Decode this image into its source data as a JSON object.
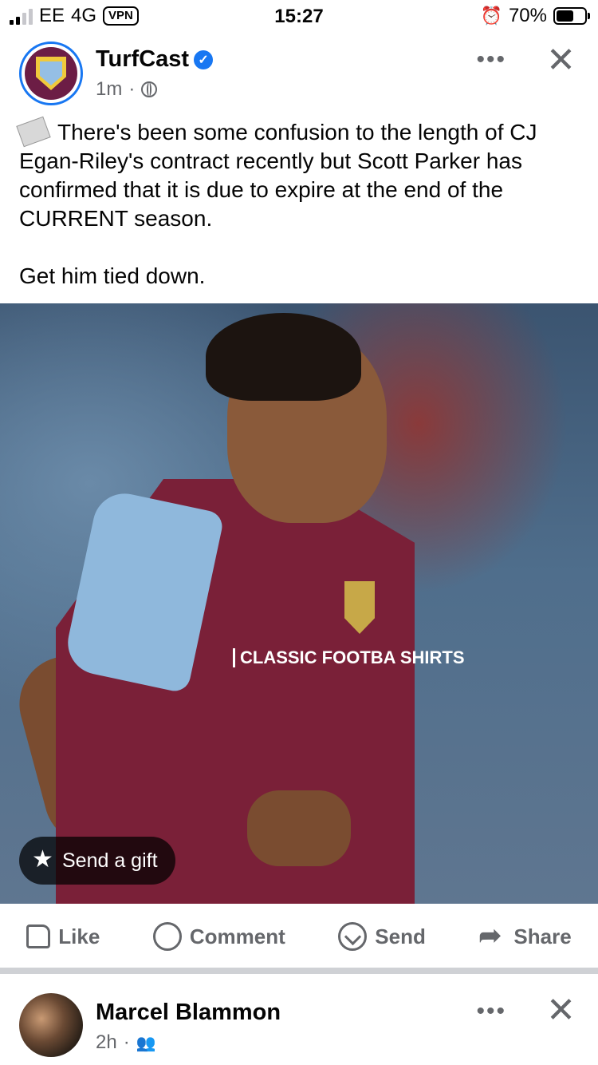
{
  "status_bar": {
    "carrier": "EE",
    "network": "4G",
    "vpn": "VPN",
    "time": "15:27",
    "battery_percent": "70%",
    "battery_level": 0.7,
    "signal_bars": 2
  },
  "post": {
    "author": "TurfCast",
    "verified": true,
    "timestamp": "1m",
    "separator": "·",
    "audience_icon": "globe-icon",
    "more_icon": "•••",
    "close_icon": "✕",
    "text_lines": [
      "There's been some confusion to the length of CJ Egan-Riley's contract recently but Scott Parker has confirmed that it is due to expire at the end of the CURRENT season.",
      "Get him tied down."
    ],
    "text_icon": "newspaper-icon",
    "image": {
      "sponsor_text": "CLASSIC FOOTBA SHIRTS",
      "send_gift_label": "Send a gift"
    }
  },
  "actions": {
    "like": "Like",
    "comment": "Comment",
    "send": "Send",
    "share": "Share"
  },
  "next_post": {
    "author": "Marcel Blammon",
    "timestamp": "2h",
    "separator": "·",
    "audience_icon": "friends-icon",
    "more_icon": "•••",
    "close_icon": "✕"
  },
  "colors": {
    "accent": "#1877f2",
    "secondary_text": "#65676b",
    "divider": "#cfd1d5",
    "claret": "#7a2038",
    "sky_blue": "#8fb8dc"
  }
}
